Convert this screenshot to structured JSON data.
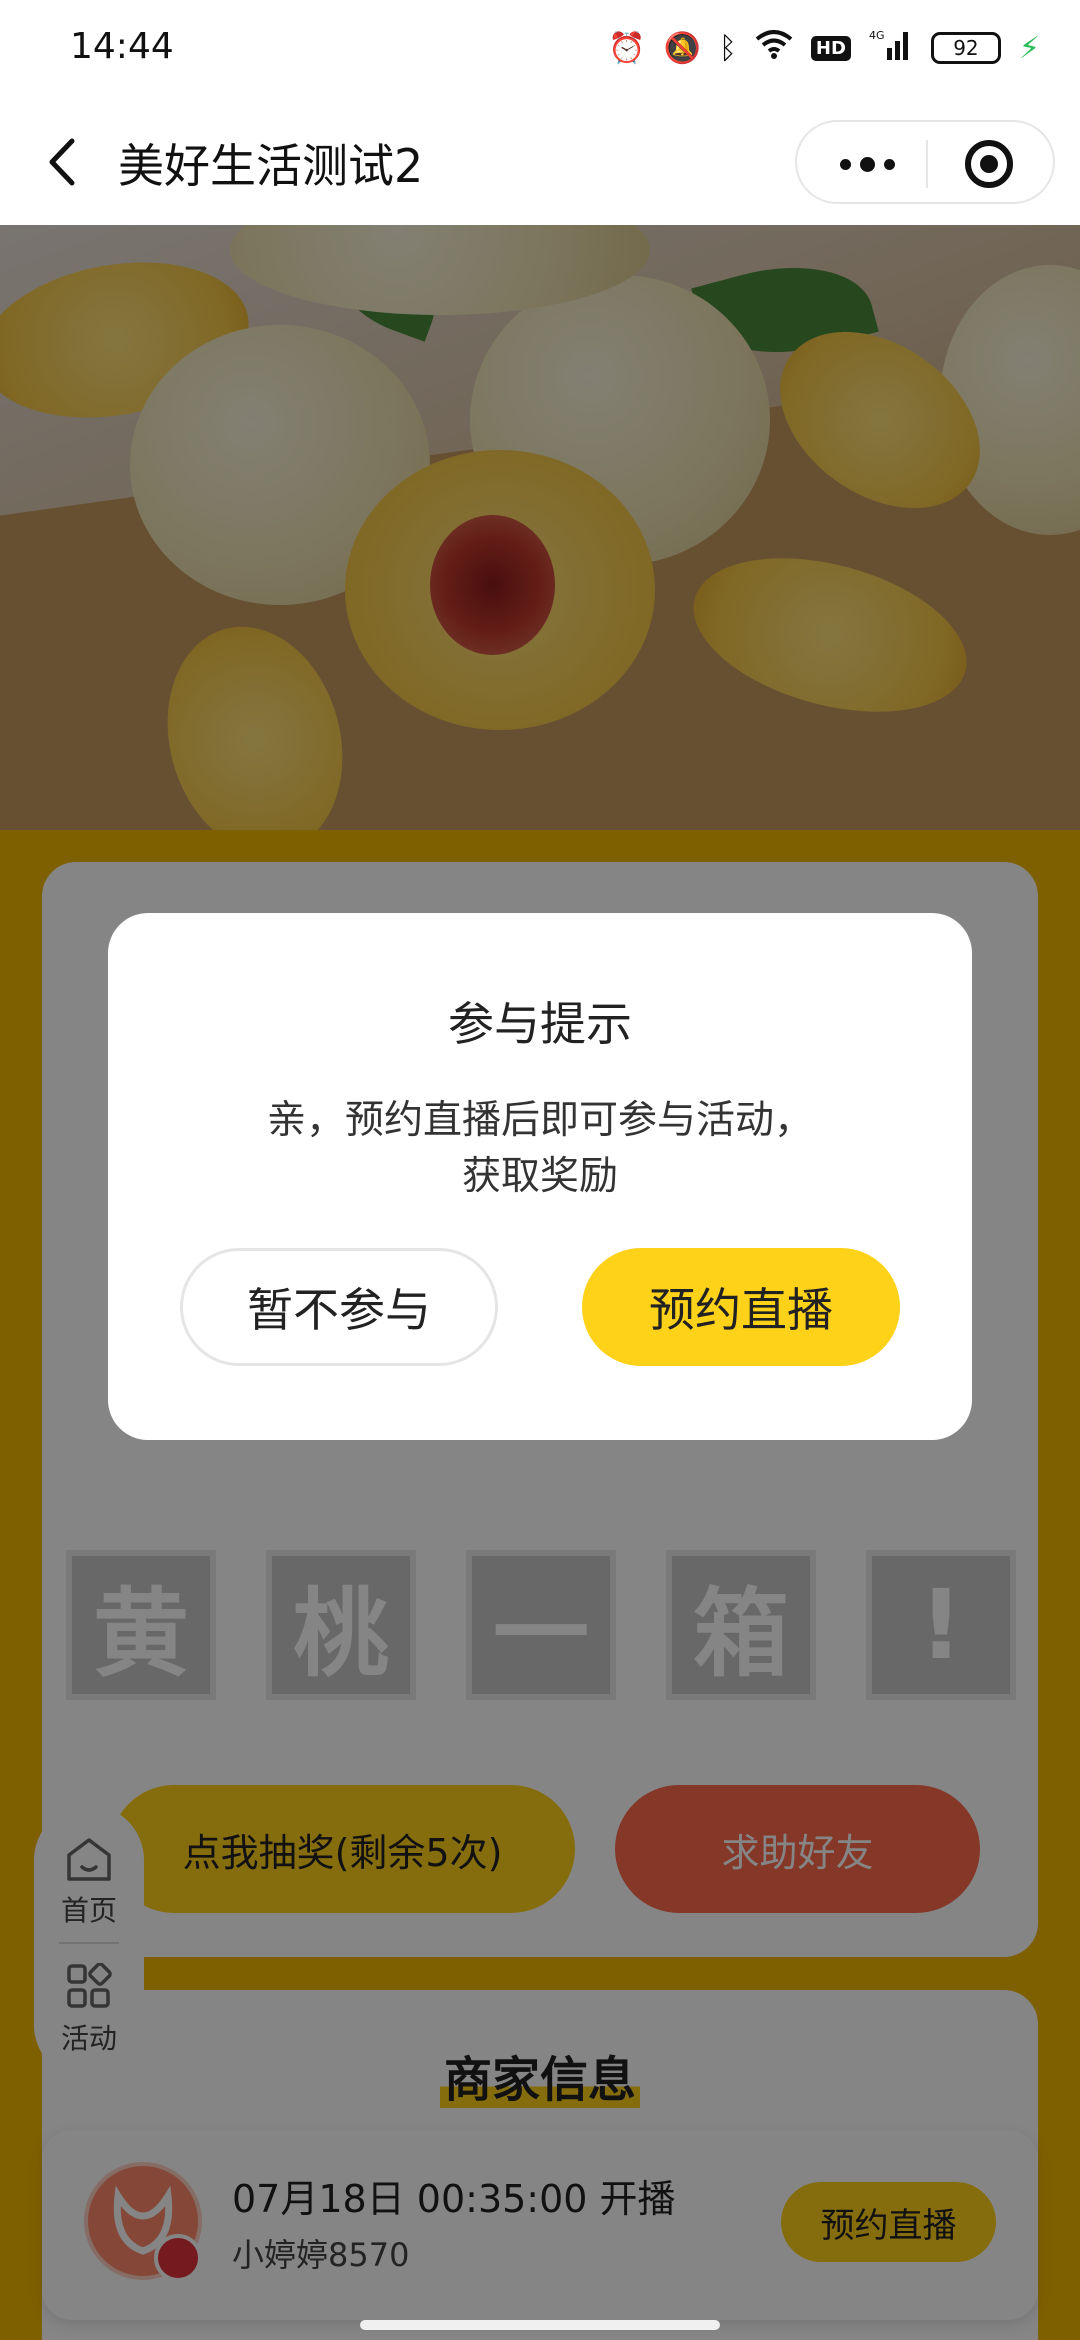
{
  "status_bar": {
    "time": "14:44",
    "network": "4G",
    "hd": "HD",
    "battery": "92"
  },
  "nav": {
    "title": "美好生活测试2"
  },
  "activity": {
    "word_tiles": [
      "黄",
      "桃",
      "一",
      "箱",
      "!"
    ],
    "lottery_button": "点我抽奖(剩余5次)",
    "help_button": "求助好友"
  },
  "side_float": {
    "home_label": "首页",
    "activity_label": "活动"
  },
  "merchant": {
    "title": "商家信息",
    "live_time": "07月18日 00:35:00 开播",
    "name": "小婷婷8570",
    "book_button": "预约直播"
  },
  "modal": {
    "title": "参与提示",
    "message_line1": "亲，预约直播后即可参与活动，",
    "message_line2": "获取奖励",
    "cancel_button": "暂不参与",
    "confirm_button": "预约直播"
  },
  "colors": {
    "accent_yellow": "#ffd21a",
    "help_red": "#ff6a4d",
    "page_background": "#f3b800"
  }
}
